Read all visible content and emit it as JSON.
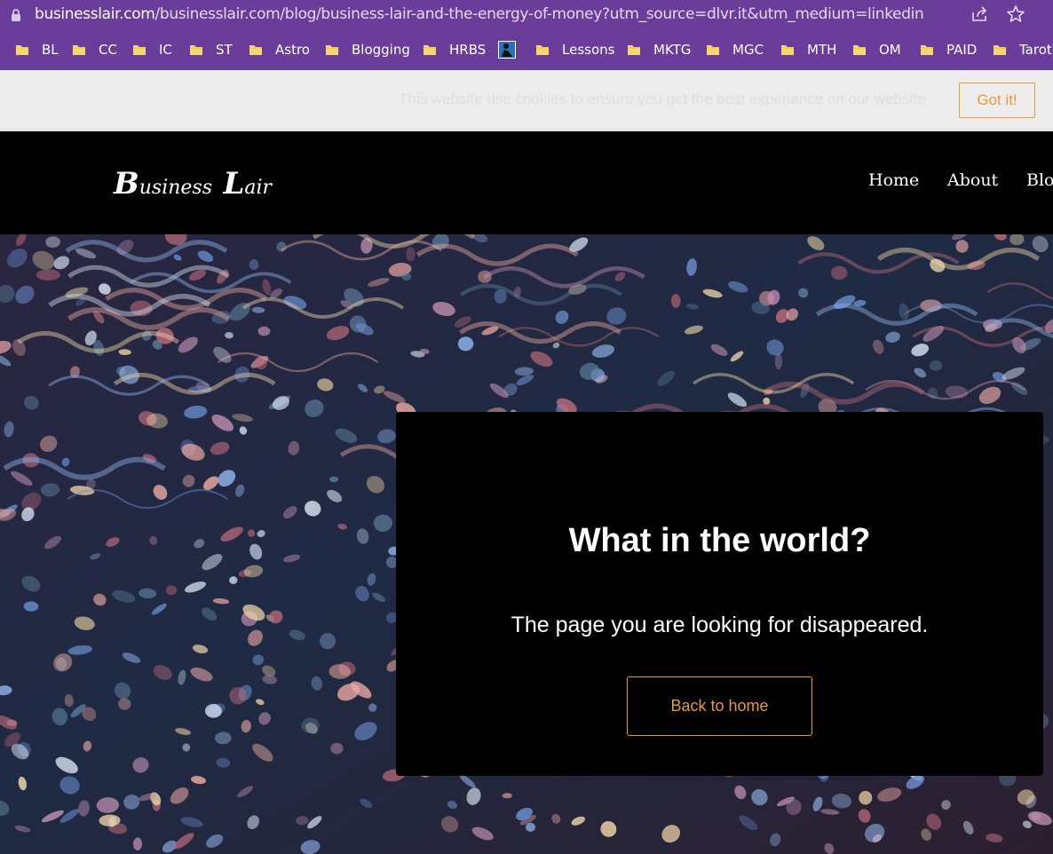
{
  "browser": {
    "url_host": "businesslair.com",
    "url_path": "/businesslair.com/blog/business-lair-and-the-energy-of-money?utm_source=dlvr.it&utm_medium=linkedin",
    "icons": {
      "lock": "lock-icon",
      "share": "share-icon",
      "bookmark": "star-icon"
    }
  },
  "bookmarks": [
    {
      "label": "BL"
    },
    {
      "label": "CC"
    },
    {
      "label": "IC"
    },
    {
      "label": "ST"
    },
    {
      "label": "Astro"
    },
    {
      "label": "Blogging"
    },
    {
      "label": "HRBS"
    },
    {
      "label": ""
    },
    {
      "label": "Lessons"
    },
    {
      "label": "MKTG"
    },
    {
      "label": "MGC"
    },
    {
      "label": "MTH"
    },
    {
      "label": "OM"
    },
    {
      "label": "PAID"
    },
    {
      "label": "Tarot"
    }
  ],
  "cookie_banner": {
    "text": "This website use cookies to ensure you get the best experience on our website",
    "button": "Got it!"
  },
  "header": {
    "logo_first_big": "B",
    "logo_first_rest": "usiness",
    "logo_second_big": "L",
    "logo_second_rest": "air",
    "nav": [
      "Home",
      "About",
      "Blog"
    ]
  },
  "error": {
    "title": "What in the world?",
    "subtitle": "The page you are looking for disappeared.",
    "button": "Back to home"
  },
  "colors": {
    "browser_chrome": "#6a3d9a",
    "accent": "#e39a3f",
    "cookie_bg": "#ececec"
  }
}
